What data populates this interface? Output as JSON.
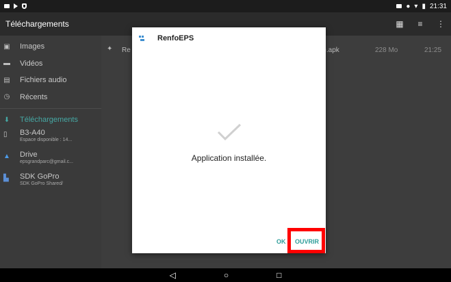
{
  "status_bar": {
    "time": "21:31"
  },
  "app_bar": {
    "title": "Téléchargements",
    "actions": [
      "grid-view-icon",
      "sort-icon",
      "more-icon"
    ]
  },
  "sidebar": {
    "items": [
      {
        "label": "Images",
        "icon": "image-icon"
      },
      {
        "label": "Vidéos",
        "icon": "video-icon"
      },
      {
        "label": "Fichiers audio",
        "icon": "audio-icon"
      },
      {
        "label": "Récents",
        "icon": "clock-icon"
      },
      {
        "label": "Téléchargements",
        "icon": "download-icon",
        "active": true
      }
    ],
    "devices": [
      {
        "name": "B3-A40",
        "detail": "Espace disponible : 14...",
        "icon": "tablet-icon"
      },
      {
        "name": "Drive",
        "detail": "epsgrandparc@gmail.c...",
        "icon": "drive-icon"
      },
      {
        "name": "SDK GoPro",
        "detail": "SDK GoPro Shared/",
        "icon": "gopro-icon"
      }
    ]
  },
  "file_list": [
    {
      "name_visible_start": "Re",
      "name_visible_end": "1).apk",
      "size": "228 Mo",
      "time": "21:25"
    }
  ],
  "dialog": {
    "app_name": "RenfoEPS",
    "message": "Application installée.",
    "buttons": {
      "ok": "OK",
      "open": "OUVRIR"
    }
  },
  "colors": {
    "accent": "#46a8a4",
    "highlight": "#ff0000",
    "dialog_bg": "#ffffff"
  }
}
